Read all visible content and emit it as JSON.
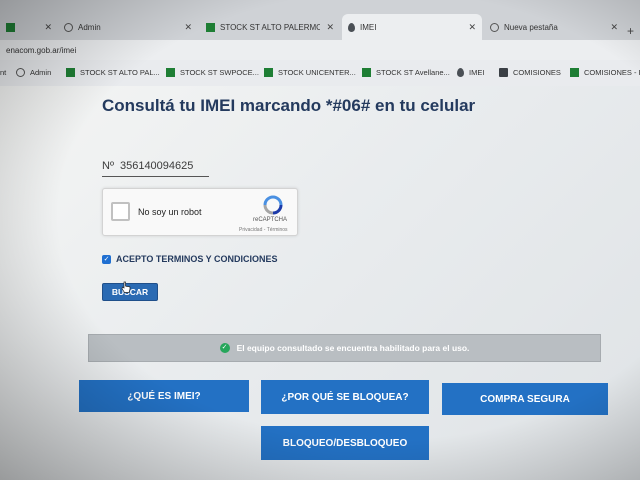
{
  "tabs": [
    {
      "label": "",
      "icon": "spreadsheet-icon"
    },
    {
      "label": "Admin",
      "icon": "globe-icon"
    },
    {
      "label": "STOCK ST ALTO PALERMO F",
      "icon": "spreadsheet-icon"
    },
    {
      "label": "IMEI",
      "icon": "enacom-drop-icon",
      "active": true
    },
    {
      "label": "Nueva pestaña",
      "icon": "globe-icon"
    }
  ],
  "url": "enacom.gob.ar/imei",
  "bookmarks": [
    {
      "label": "nt",
      "icon": ""
    },
    {
      "label": "Admin",
      "icon": "globe-icon"
    },
    {
      "label": "STOCK ST ALTO PAL...",
      "icon": "spreadsheet-icon"
    },
    {
      "label": "STOCK ST SWPOCE...",
      "icon": "spreadsheet-icon"
    },
    {
      "label": "STOCK UNICENTER...",
      "icon": "spreadsheet-icon"
    },
    {
      "label": "STOCK ST Avellane...",
      "icon": "spreadsheet-icon"
    },
    {
      "label": "IMEI",
      "icon": "enacom-drop-icon"
    },
    {
      "label": "COMISIONES",
      "icon": "list-icon"
    },
    {
      "label": "COMISIONES - F",
      "icon": "spreadsheet-icon"
    }
  ],
  "page": {
    "title": "Consultá tu IMEI marcando *#06# en tu celular",
    "imei": {
      "prefix": "Nº",
      "value": "356140094625"
    },
    "captcha": {
      "label": "No soy un robot",
      "brand": "reCAPTCHA",
      "links": "Privacidad - Términos"
    },
    "terms": {
      "label": "ACEPTO TERMINOS Y CONDICIONES",
      "checked": true
    },
    "search_button": "BUSCAR",
    "alert": "El equipo consultado se encuentra habilitado para el uso.",
    "nav_buttons": [
      "¿QUÉ ES IMEI?",
      "¿POR QUÉ SE BLOQUEA?",
      "COMPRA SEGURA",
      "BLOQUEO/DESBLOQUEO"
    ]
  },
  "colors": {
    "title": "#243a5e",
    "button": "#2371c4",
    "alert_bg": "#b9bec2",
    "success": "#26a65b"
  }
}
